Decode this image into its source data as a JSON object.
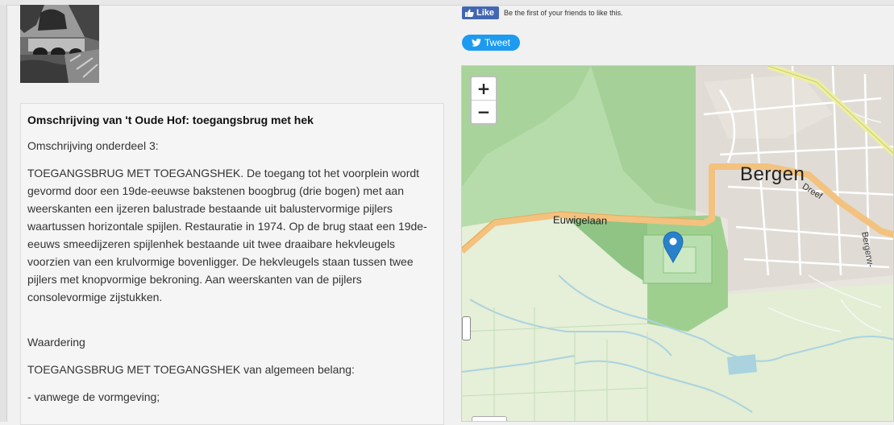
{
  "social": {
    "like_label": "Like",
    "like_text": "Be the first of your friends to like this.",
    "tweet_label": "Tweet"
  },
  "description": {
    "title": "Omschrijving van 't Oude Hof: toegangsbrug met hek",
    "subtitle": "Omschrijving onderdeel 3:",
    "body": "TOEGANGSBRUG MET TOEGANGSHEK. De toegang tot het voorplein wordt gevormd door een 19de-eeuwse bakstenen boogbrug (drie bogen) met aan weerskanten een ijzeren balustrade bestaande uit balustervormige pijlers waartussen horizontale spijlen. Restauratie in 1974. Op de brug staat een 19de-eeuws smeedijzeren spijlenhek bestaande uit twee draaibare hekvleugels voorzien van een krulvormige bovenligger. De hekvleugels staan tussen twee pijlers met knopvormige bekroning. Aan weerskanten van de pijlers consolevormige zijstukken.",
    "waardering_heading": "Waardering",
    "waardering_text": "TOEGANGSBRUG MET TOEGANGSHEK van algemeen belang:",
    "reason_1": "- vanwege de vormgeving;"
  },
  "map": {
    "zoom_in": "+",
    "zoom_out": "−",
    "labels": {
      "bergen": "Bergen",
      "euwigelaan": "Euwigelaan",
      "dreef": "Dreef",
      "bergerweg": "Bergerw-"
    }
  },
  "colors": {
    "facebook_blue": "#4267b2",
    "twitter_blue": "#1d9bf0",
    "marker_blue": "#2a81cb",
    "forest_green": "#a8d39a",
    "road_orange": "#f5c68d"
  }
}
